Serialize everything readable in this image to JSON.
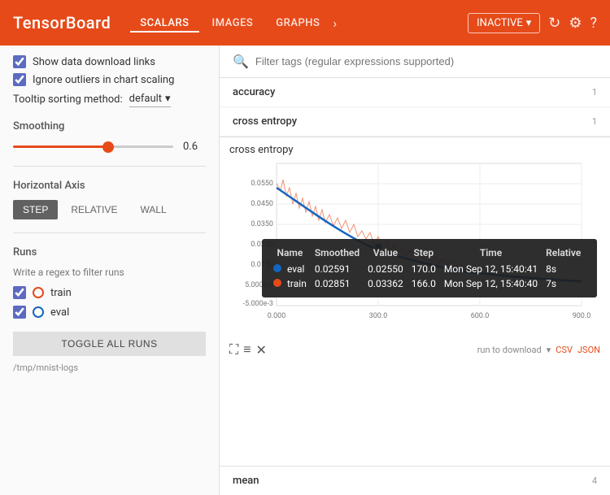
{
  "header": {
    "logo": "TensorBoard",
    "nav": [
      {
        "label": "SCALARS",
        "active": true
      },
      {
        "label": "IMAGES",
        "active": false
      },
      {
        "label": "GRAPHS",
        "active": false
      }
    ],
    "nav_more": "›",
    "status": "INACTIVE",
    "icons": [
      "↻",
      "⚙",
      "?"
    ]
  },
  "sidebar": {
    "checkboxes": [
      {
        "label": "Show data download links",
        "checked": true
      },
      {
        "label": "Ignore outliers in chart scaling",
        "checked": true
      }
    ],
    "tooltip_label": "Tooltip sorting method:",
    "tooltip_value": "default",
    "smoothing_label": "Smoothing",
    "smoothing_value": "0.6",
    "smoothing_pct": 60,
    "axis_label": "Horizontal Axis",
    "axis_buttons": [
      {
        "label": "STEP",
        "active": true
      },
      {
        "label": "RELATIVE",
        "active": false
      },
      {
        "label": "WALL",
        "active": false
      }
    ],
    "runs_label": "Runs",
    "runs_filter": "Write a regex to filter runs",
    "runs": [
      {
        "label": "train",
        "color": "#E64A19",
        "checked": true
      },
      {
        "label": "eval",
        "color": "#1565C0",
        "checked": true
      }
    ],
    "toggle_all": "TOGGLE ALL RUNS",
    "log_path": "/tmp/mnist-logs"
  },
  "content": {
    "search_placeholder": "Filter tags (regular expressions supported)",
    "tags": [
      {
        "name": "accuracy",
        "count": "1"
      },
      {
        "name": "cross entropy",
        "count": "1"
      }
    ],
    "chart": {
      "title": "cross entropy",
      "y_labels": [
        "0.0550",
        "0.0450",
        "0.0350",
        "0.0250",
        "0.0150",
        "5.000e-3",
        "-5.000e-3"
      ],
      "x_labels": [
        "0.000",
        "300.0",
        "600.0",
        "900.0"
      ],
      "toolbar_icons": [
        "⛶",
        "≡",
        "✕"
      ],
      "download_label": "run to download",
      "download_links": [
        "CSV",
        "JSON"
      ]
    },
    "tooltip": {
      "headers": [
        "Name",
        "Smoothed",
        "Value",
        "Step",
        "Time",
        "Relative"
      ],
      "rows": [
        {
          "color": "#1565C0",
          "name": "eval",
          "smoothed": "0.02591",
          "value": "0.02550",
          "step": "170.0",
          "time": "Mon Sep 12, 15:40:41",
          "relative": "8s"
        },
        {
          "color": "#E64A19",
          "name": "train",
          "smoothed": "0.02851",
          "value": "0.03362",
          "step": "166.0",
          "time": "Mon Sep 12, 15:40:40",
          "relative": "7s"
        }
      ]
    },
    "mean_label": "mean",
    "mean_count": "4"
  }
}
